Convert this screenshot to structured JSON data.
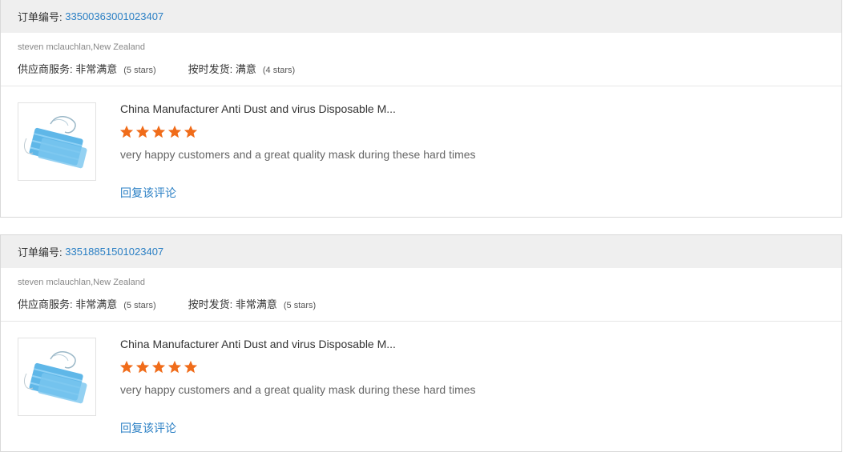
{
  "order_label": "订单编号:",
  "supplier_label": "供应商服务:",
  "shipping_label": "按时发货:",
  "star_color": "#f06c1a",
  "link_color": "#2a7fc4",
  "reviews": [
    {
      "order_number": "33500363001023407",
      "buyer": "steven mclauchlan,New Zealand",
      "supplier_value": "非常满意",
      "supplier_stars": "(5 stars)",
      "shipping_value": "满意",
      "shipping_stars": "(4 stars)",
      "product_title": "China Manufacturer Anti Dust and virus Disposable M...",
      "rating": 5,
      "comment": "very happy customers and a great quality mask during these hard times",
      "reply_label": "回复该评论"
    },
    {
      "order_number": "33518851501023407",
      "buyer": "steven mclauchlan,New Zealand",
      "supplier_value": "非常满意",
      "supplier_stars": "(5 stars)",
      "shipping_value": "非常满意",
      "shipping_stars": "(5 stars)",
      "product_title": "China Manufacturer Anti Dust and virus Disposable M...",
      "rating": 5,
      "comment": "very happy customers and a great quality mask during these hard times",
      "reply_label": "回复该评论"
    }
  ]
}
